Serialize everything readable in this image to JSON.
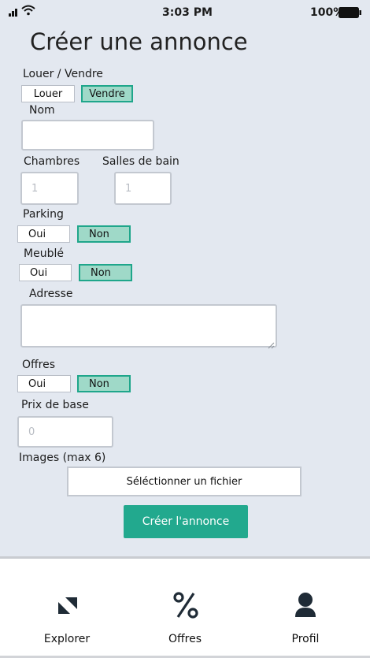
{
  "status_bar": {
    "time": "3:03 PM",
    "battery": "100%"
  },
  "page": {
    "title": "Créer une annonce"
  },
  "form": {
    "louer_vendre": {
      "label": "Louer / Vendre",
      "options": [
        "Louer",
        "Vendre"
      ],
      "selected": "Vendre"
    },
    "nom": {
      "label": "Nom",
      "value": ""
    },
    "chambres": {
      "label": "Chambres",
      "placeholder": "1"
    },
    "salles_de_bain": {
      "label": "Salles de bain",
      "placeholder": "1"
    },
    "parking": {
      "label": "Parking",
      "options": [
        "Oui",
        "Non"
      ],
      "selected": "Non"
    },
    "meuble": {
      "label": "Meublé",
      "options": [
        "Oui",
        "Non"
      ],
      "selected": "Non"
    },
    "adresse": {
      "label": "Adresse",
      "value": ""
    },
    "offres": {
      "label": "Offres",
      "options": [
        "Oui",
        "Non"
      ],
      "selected": "Non"
    },
    "prix_de_base": {
      "label": "Prix de base",
      "placeholder": "0"
    },
    "images": {
      "label": "Images (max 6)",
      "button_label": "Séléctionner un fichier"
    },
    "submit_label": "Créer l'annonce"
  },
  "tab_bar": {
    "items": [
      {
        "label": "Explorer",
        "icon": "explore-icon"
      },
      {
        "label": "Offres",
        "icon": "percent-icon"
      },
      {
        "label": "Profil",
        "icon": "user-icon"
      }
    ]
  },
  "colors": {
    "accent": "#22a98e",
    "selected_fill": "#9fd9c8",
    "form_background": "#e3e8f0"
  }
}
